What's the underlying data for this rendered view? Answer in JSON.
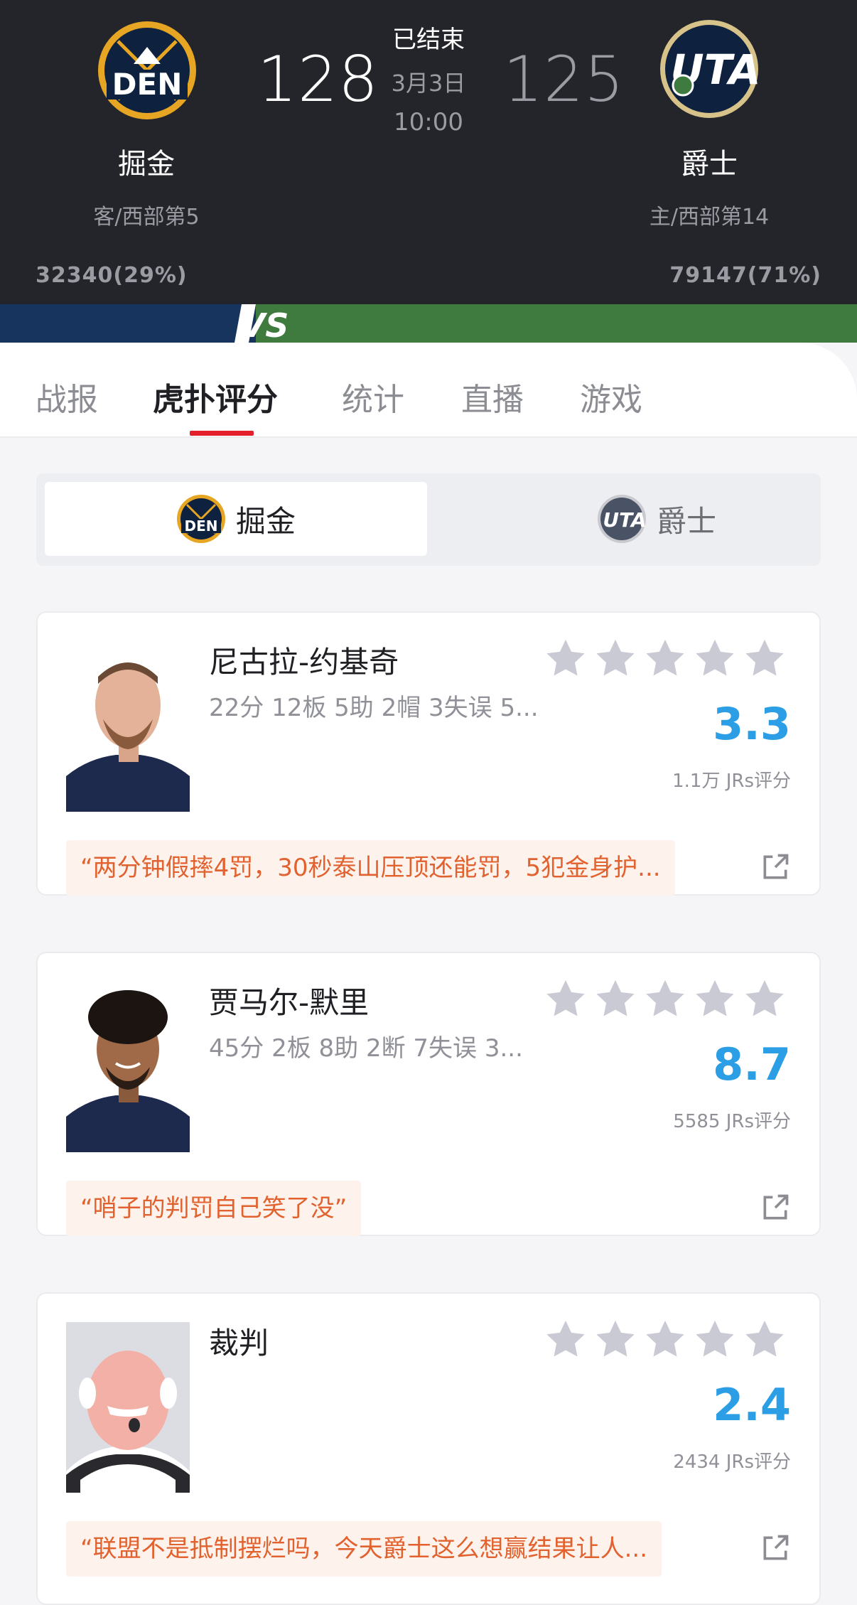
{
  "game": {
    "status": "已结束",
    "date": "3月3日",
    "time": "10:00",
    "away": {
      "name": "掘金",
      "abbr": "DEN",
      "score": "128",
      "rank": "客/西部第5",
      "votes": "32340(29%)"
    },
    "home": {
      "name": "爵士",
      "abbr": "UTA",
      "score": "125",
      "rank": "主/西部第14",
      "votes": "79147(71%)"
    },
    "vs": "VS"
  },
  "tabs": [
    "战报",
    "虎扑评分",
    "统计",
    "直播",
    "游戏"
  ],
  "active_tab": "虎扑评分",
  "team_switch": {
    "active": "掘金",
    "inactive": "爵士"
  },
  "players": [
    {
      "name": "尼古拉-约基奇",
      "stats": "22分 12板 5助 2帽 3失误 5...",
      "rating": "3.3",
      "raters": "1.1万 JRs评分",
      "quote": "“两分钟假摔4罚，30秒泰山压顶还能罚，5犯金身护..."
    },
    {
      "name": "贾马尔-默里",
      "stats": "45分 2板 8助 2断 7失误 3...",
      "rating": "8.7",
      "raters": "5585 JRs评分",
      "quote": "“哨子的判罚自己笑了没”"
    },
    {
      "name": "裁判",
      "stats": "",
      "rating": "2.4",
      "raters": "2434 JRs评分",
      "quote": "“联盟不是抵制摆烂吗，今天爵士这么想赢结果让人..."
    }
  ],
  "colors": {
    "header_bg": "#24252b",
    "away": "#17345f",
    "home": "#3f7a3f",
    "accent": "#e3202c",
    "rating": "#2c9ee6",
    "quote": "#e2622f"
  }
}
